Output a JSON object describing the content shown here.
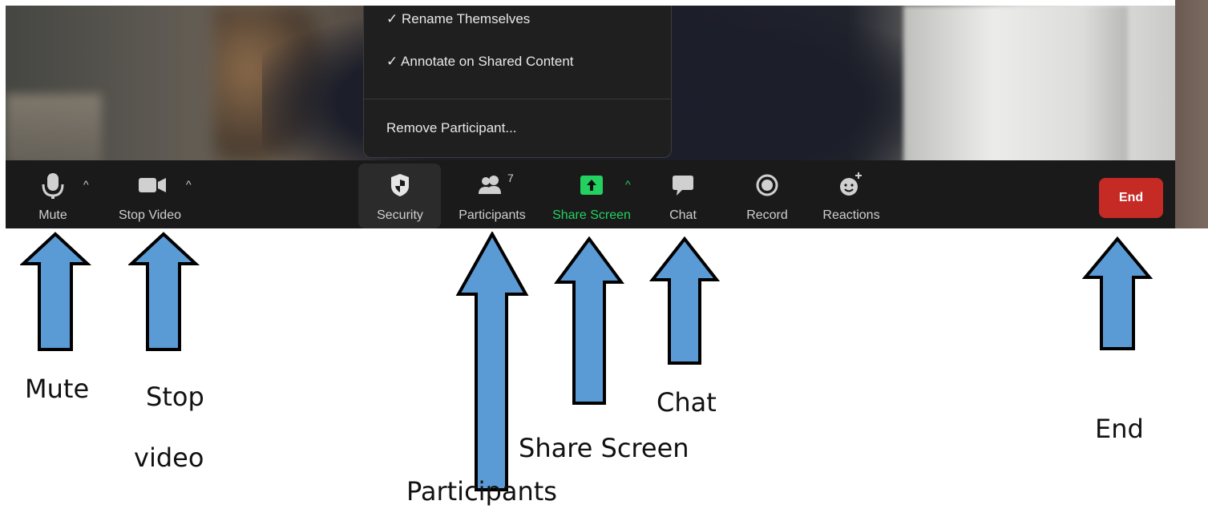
{
  "menu": {
    "items": [
      "✓ Rename Themselves",
      "✓ Annotate on Shared Content",
      "Remove Participant..."
    ]
  },
  "toolbar": {
    "mute_label": "Mute",
    "stop_video_label": "Stop Video",
    "security_label": "Security",
    "participants_label": "Participants",
    "participants_count": "7",
    "share_screen_label": "Share Screen",
    "chat_label": "Chat",
    "record_label": "Record",
    "reactions_label": "Reactions",
    "end_label": "End",
    "caret": "^"
  },
  "annotations": {
    "mute": "Mute",
    "stop": "Stop",
    "video": "video",
    "chat": "Chat",
    "share_screen": "Share Screen",
    "participants": "Participants",
    "end": "End"
  },
  "colors": {
    "share_green": "#23d160",
    "end_red": "#c52a25",
    "arrow_blue": "#5b9bd5"
  },
  "icons": [
    "microphone-icon",
    "video-camera-icon",
    "shield-icon",
    "participants-icon",
    "share-screen-icon",
    "chat-bubble-icon",
    "record-icon",
    "reactions-icon"
  ]
}
